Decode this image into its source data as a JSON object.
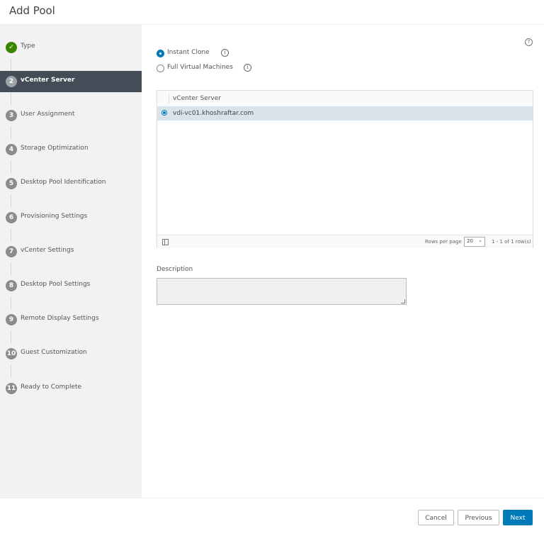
{
  "header": {
    "title": "Add Pool"
  },
  "wizard": {
    "steps": [
      {
        "number": "✓",
        "label": "Type",
        "state": "done"
      },
      {
        "number": "2",
        "label": "vCenter Server",
        "state": "active"
      },
      {
        "number": "3",
        "label": "User Assignment",
        "state": "pending"
      },
      {
        "number": "4",
        "label": "Storage Optimization",
        "state": "pending"
      },
      {
        "number": "5",
        "label": "Desktop Pool Identification",
        "state": "pending"
      },
      {
        "number": "6",
        "label": "Provisioning Settings",
        "state": "pending"
      },
      {
        "number": "7",
        "label": "vCenter Settings",
        "state": "pending"
      },
      {
        "number": "8",
        "label": "Desktop Pool Settings",
        "state": "pending"
      },
      {
        "number": "9",
        "label": "Remote Display Settings",
        "state": "pending"
      },
      {
        "number": "10",
        "label": "Guest Customization",
        "state": "pending"
      },
      {
        "number": "11",
        "label": "Ready to Complete",
        "state": "pending"
      }
    ]
  },
  "main": {
    "help_icon": "?",
    "clone_options": [
      {
        "label": "Instant Clone",
        "selected": true,
        "info_icon": "i"
      },
      {
        "label": "Full Virtual Machines",
        "selected": false,
        "info_icon": "i"
      }
    ],
    "grid": {
      "column_header": "vCenter Server",
      "rows": [
        {
          "value": "vdi-vc01.khoshraftar.com",
          "selected": true
        }
      ],
      "footer": {
        "rows_per_page_label": "Rows per page",
        "rows_per_page_value": "20",
        "pager_text": "1 - 1 of 1 row(s)"
      }
    },
    "description": {
      "label": "Description",
      "value": ""
    }
  },
  "footer": {
    "cancel_label": "Cancel",
    "previous_label": "Previous",
    "next_label": "Next"
  },
  "colors": {
    "primary": "#0079b8",
    "done_step": "#3c8500",
    "active_step_bg": "#434c57",
    "selected_row_bg": "#d9e4ea"
  }
}
